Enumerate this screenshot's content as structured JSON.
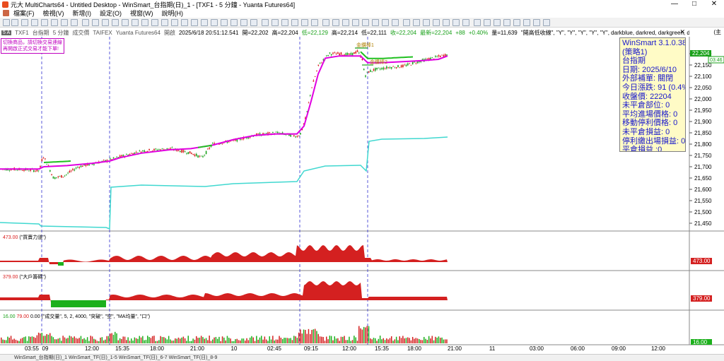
{
  "window": {
    "title": "元大 MultiCharts64 - Untitled Desktop - WinSmart_台指期(日)_1 - [TXF1 - 5 分鐘 - Yuanta Futures64]",
    "minimize": "—",
    "maximize": "□",
    "close": "✕"
  },
  "menu": [
    "檔案(F)",
    "檢視(V)",
    "新增(I)",
    "設定(O)",
    "視窗(W)",
    "說明(H)"
  ],
  "infobar": {
    "symbol_badge": "5 A",
    "symbol": "TXF1",
    "name": "台指期",
    "interval": "5 分鐘",
    "session": "成交價",
    "exchange": "TAIFEX",
    "datafeed": "Yuanta Futures64",
    "status": "開啟",
    "datetime": "2025/6/18  20:51:12.541",
    "open": "開=22,202",
    "high": "高=22,204",
    "low": "低=22,129",
    "close_l": "高=22,214",
    "low2": "低=22,111",
    "close": "收=22,204",
    "last": "最新=22,204",
    "change": "+88",
    "change_pct": "+0.40%",
    "volume": "量=11,639",
    "strategy_args": "\"開高低收線\", \"Y\", \"Y\", \"Y\", \"Y\", \"Y\", darkblue, darkred, darkgreen, darkyellow, \"N\", 50, 50, 1, 1, \"區間最高點\", \"區間",
    "extra": "(主"
  },
  "notice": {
    "line1": "切換商品，請切換交易連線",
    "line2": "再開啟正式交易才能下單!"
  },
  "chart_labels": {
    "signal1": "金鑽棒1",
    "signal2": "金鑽棒2"
  },
  "winsmart": {
    "title": "WinSmart 3.1.0.38",
    "strategy": "(策略1)",
    "product": "台指期",
    "date": "日期: 2025/6/10",
    "external": "外部補單: 關閉",
    "change": "今日漲跌: 91 (0.4%)",
    "close": "收盤價: 22204",
    "position": "未平倉部位: 0",
    "avg_price": "平均進場價格: 0",
    "trail": "移動停利價格: 0",
    "open_pl": "未平倉損益: 0",
    "stop_pl": "停利繳出場損益: 0",
    "closed_pl": "平倉損益 :0"
  },
  "price_axis": {
    "ticks": [
      "22,200",
      "22,150",
      "22,100",
      "22,050",
      "22,000",
      "21,950",
      "21,900",
      "21,850",
      "21,800",
      "21,750",
      "21,700",
      "21,650",
      "21,600",
      "21,550",
      "21,500",
      "21,450"
    ],
    "last_tag": "22,204",
    "last_tag2": "03:46"
  },
  "panels": {
    "p1": {
      "val": "473.00",
      "name": "(\"買賣力道\")",
      "tag": "473.00"
    },
    "p2": {
      "val": "379.00",
      "name": "(\"大戶籌碼\")",
      "tag": "379.00"
    },
    "p3": {
      "val1": "16.00",
      "val2": "79.00",
      "val3": "0.00",
      "name": "(\"成交量\", 5, 2, 4000, \"突破\", \"空\", \"MA均量\", \"口\")",
      "tag": "16.00"
    }
  },
  "xaxis": [
    "03:55",
    "09",
    "12:00",
    "15:35",
    "18:00",
    "21:00",
    "10",
    "02:45",
    "09:15",
    "12:00",
    "15:35",
    "18:00",
    "21:00",
    "11",
    "03:00",
    "06:00",
    "09:00",
    "12:00"
  ],
  "taskbar": "WinSmart_台指期(日)_1    WinSmart_TF(日)_1-5    WinSmart_TF(日)_6-7    WinSmart_TF(日)_8-9",
  "colors": {
    "candle_up": "#d91a1a",
    "candle_down": "#1aa11a",
    "ma_magenta": "#e000e0",
    "ma_green": "#20c020",
    "cyan_line": "#40d8d0",
    "panel_red": "#d42020",
    "panel_green": "#1cb01c",
    "winsmart_text": "#1818cc"
  }
}
